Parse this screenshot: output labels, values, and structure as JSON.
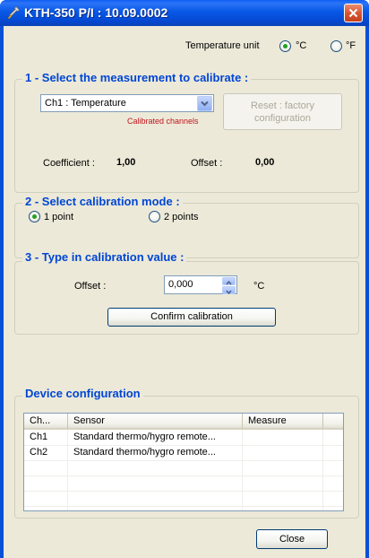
{
  "window": {
    "title": "KTH-350 P/I : 10.09.0002",
    "icon": "wrench-icon"
  },
  "temperature_unit": {
    "label": "Temperature unit",
    "options": [
      {
        "label": "°C",
        "checked": true
      },
      {
        "label": "°F",
        "checked": false
      }
    ]
  },
  "section1": {
    "title": "1 - Select the measurement to calibrate :",
    "channel_select": "Ch1 : Temperature",
    "calibrated_note": "Calibrated channels",
    "reset_button": {
      "line1": "Reset : factory",
      "line2": "configuration"
    },
    "coefficient_label": "Coefficient :",
    "coefficient_value": "1,00",
    "offset_label": "Offset :",
    "offset_value": "0,00"
  },
  "section2": {
    "title": "2 - Select calibration mode :",
    "options": [
      {
        "label": "1 point",
        "checked": true
      },
      {
        "label": "2 points",
        "checked": false
      }
    ]
  },
  "section3": {
    "title": "3 - Type in calibration value :",
    "offset_label": "Offset :",
    "offset_value": "0,000",
    "unit": "°C",
    "confirm_button": "Confirm calibration"
  },
  "device_config": {
    "title": "Device configuration",
    "columns": [
      "Ch...",
      "Sensor",
      "Measure"
    ],
    "rows": [
      {
        "ch": "Ch1",
        "sensor": "Standard thermo/hygro remote...",
        "measure": ""
      },
      {
        "ch": "Ch2",
        "sensor": "Standard thermo/hygro remote...",
        "measure": ""
      }
    ]
  },
  "close_button": "Close",
  "colors": {
    "title_bar": "#0858e6",
    "group_title": "#0046d5",
    "calibrated_note": "#c0141c",
    "window_bg": "#ece9d8"
  }
}
